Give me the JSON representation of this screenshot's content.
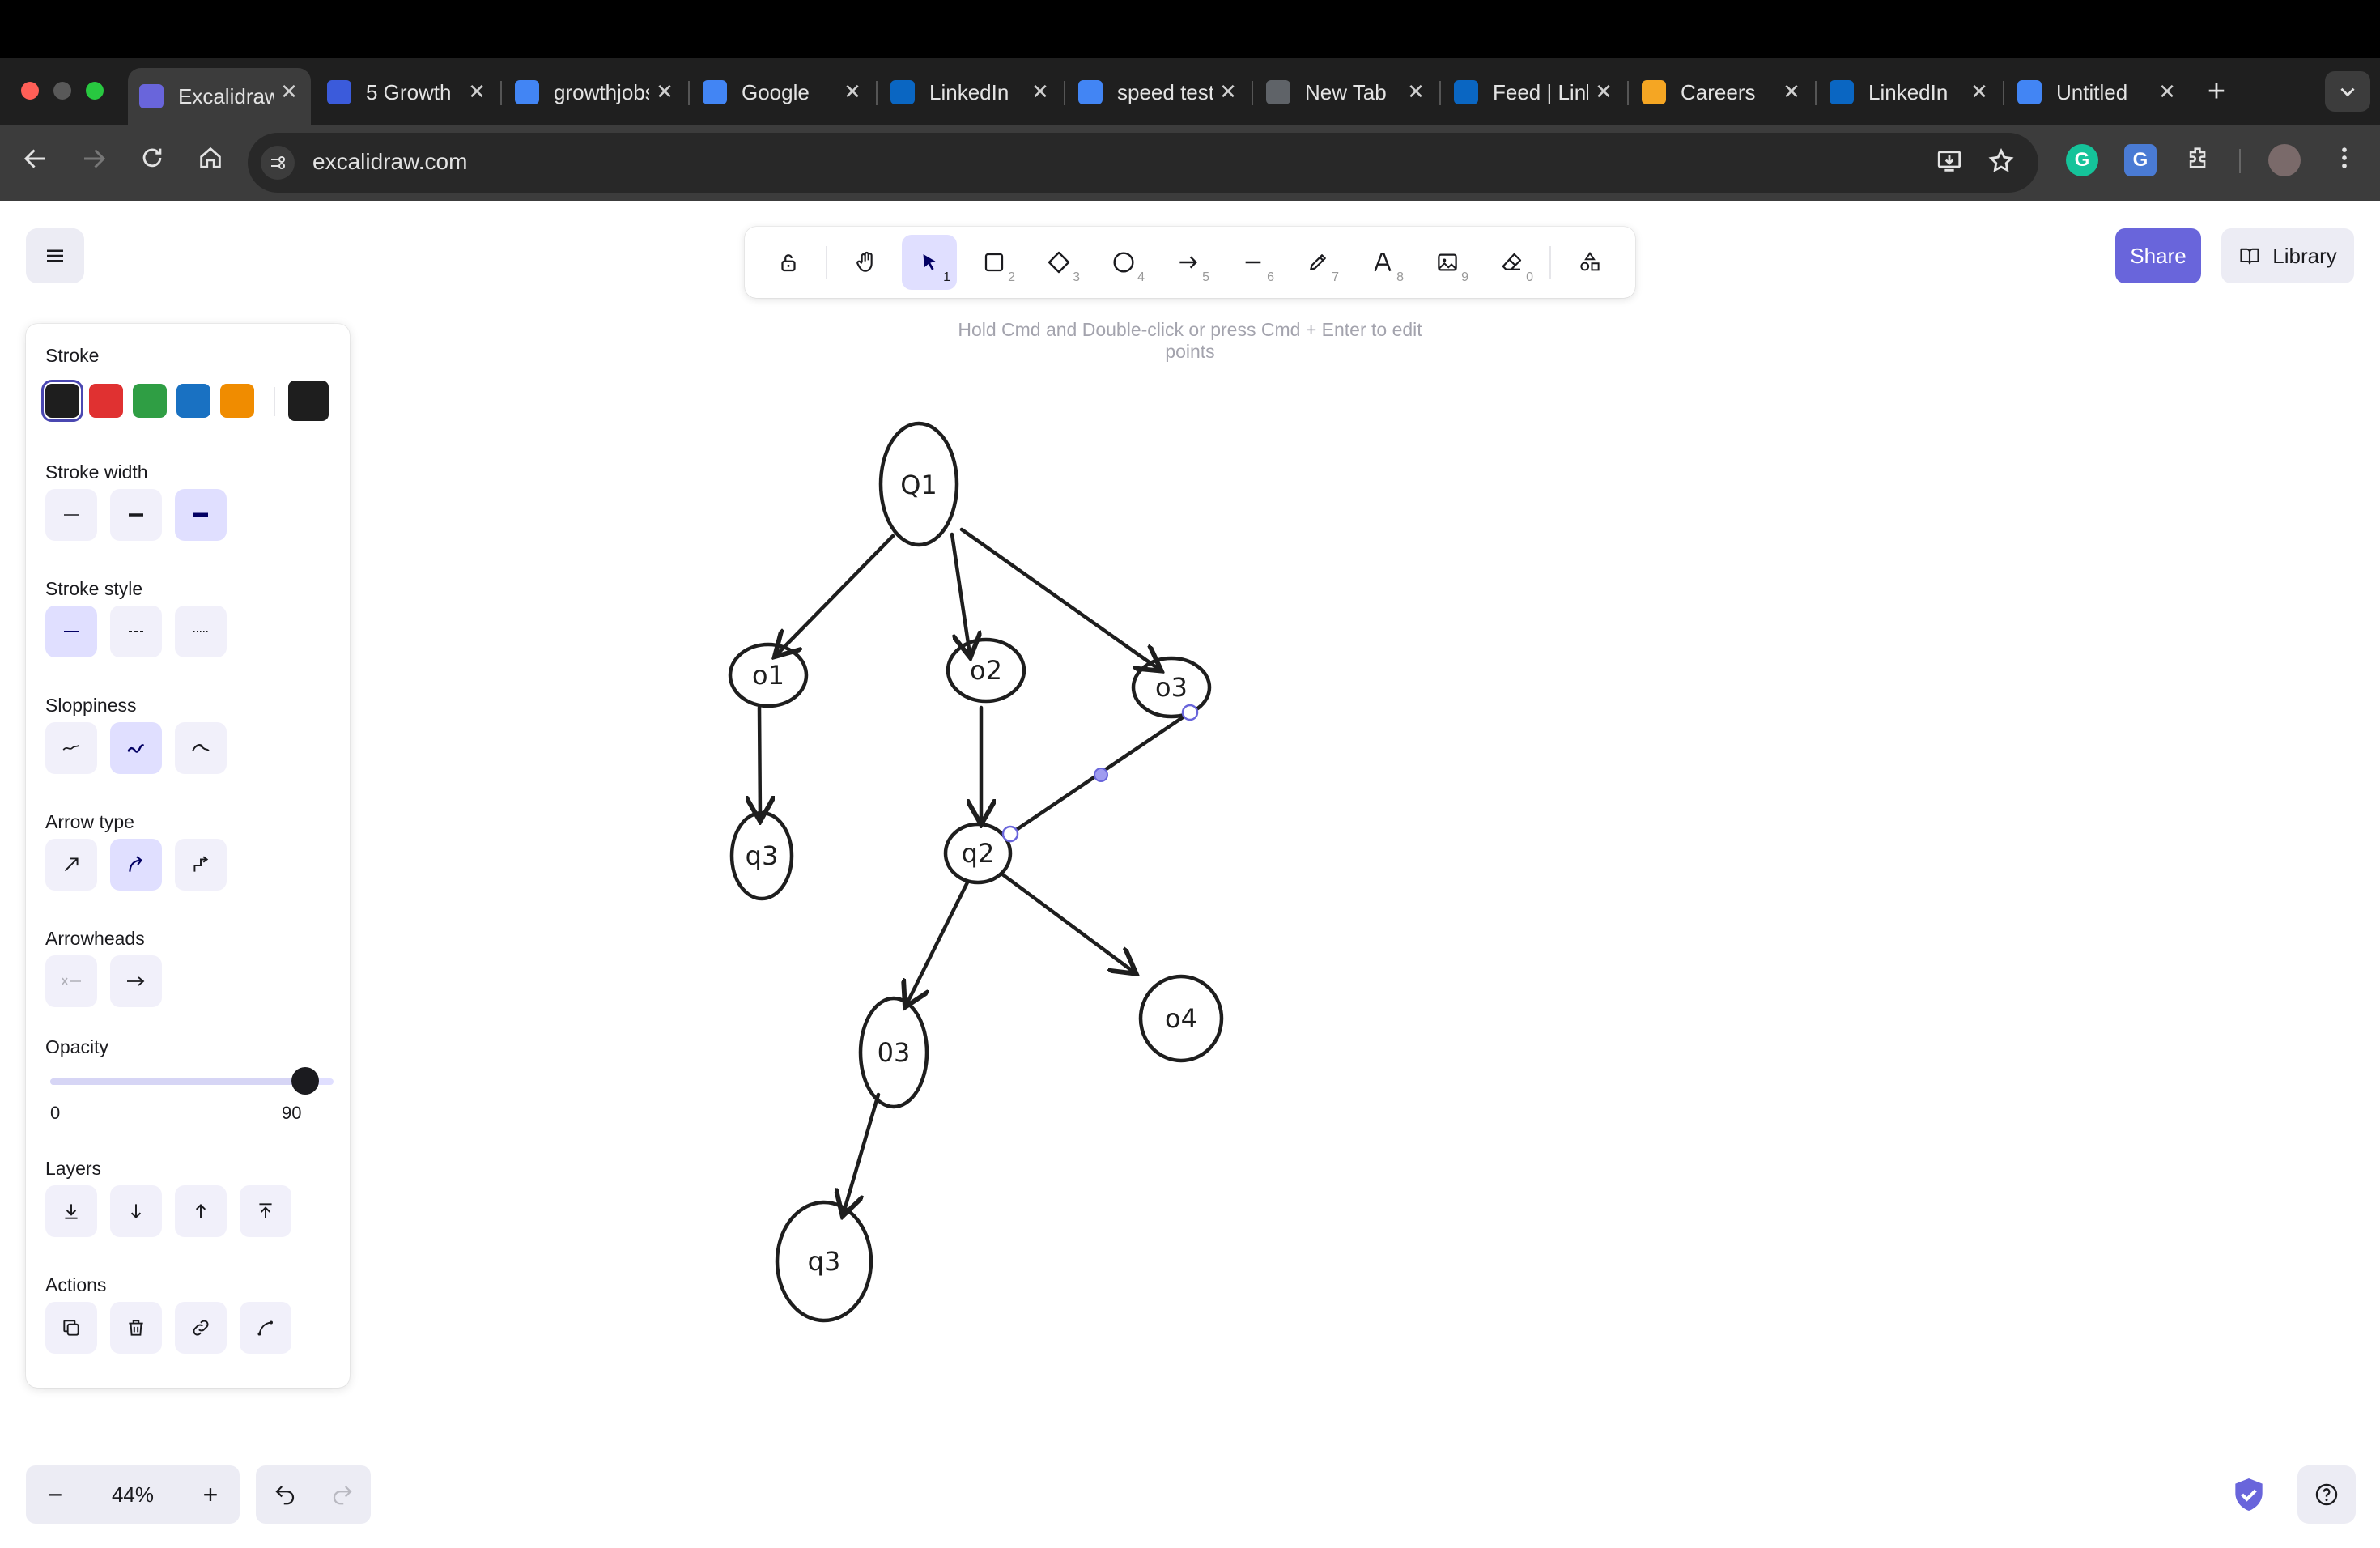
{
  "browser": {
    "tabs": [
      {
        "title": "Excalidraw",
        "favicon": "excalidraw-icon",
        "color": "#6965db",
        "active": true
      },
      {
        "title": "5 Growth",
        "favicon": "growth-icon",
        "color": "#3b5bdb",
        "active": false
      },
      {
        "title": "growthjobs",
        "favicon": "google-icon",
        "color": "#4285f4",
        "active": false
      },
      {
        "title": "Google",
        "favicon": "gemini-icon",
        "color": "#4285f4",
        "active": false
      },
      {
        "title": "LinkedIn",
        "favicon": "linkedin-icon",
        "color": "#0a66c2",
        "active": false
      },
      {
        "title": "speed test",
        "favicon": "google-icon",
        "color": "#4285f4",
        "active": false
      },
      {
        "title": "New Tab",
        "favicon": "chrome-icon",
        "color": "#5f6368",
        "active": false
      },
      {
        "title": "Feed | LinkedIn",
        "favicon": "linkedin-icon",
        "color": "#0a66c2",
        "active": false
      },
      {
        "title": "Careers",
        "favicon": "careers-icon",
        "color": "#f5a623",
        "active": false
      },
      {
        "title": "LinkedIn",
        "favicon": "linkedin-icon",
        "color": "#0a66c2",
        "active": false
      },
      {
        "title": "Untitled",
        "favicon": "docs-icon",
        "color": "#4285f4",
        "active": false
      }
    ],
    "url": "excalidraw.com",
    "close_glyph": "✕",
    "new_tab_glyph": "+"
  },
  "toolbar": {
    "tools": [
      {
        "name": "lock",
        "key": ""
      },
      {
        "name": "hand",
        "key": ""
      },
      {
        "name": "selection",
        "key": "1",
        "active": true
      },
      {
        "name": "rectangle",
        "key": "2"
      },
      {
        "name": "diamond",
        "key": "3"
      },
      {
        "name": "ellipse",
        "key": "4"
      },
      {
        "name": "arrow",
        "key": "5"
      },
      {
        "name": "line",
        "key": "6"
      },
      {
        "name": "draw",
        "key": "7"
      },
      {
        "name": "text",
        "key": "8"
      },
      {
        "name": "image",
        "key": "9"
      },
      {
        "name": "eraser",
        "key": "0"
      },
      {
        "name": "extra-tools",
        "key": ""
      }
    ],
    "hint": "Hold Cmd and Double-click or press Cmd + Enter to edit points"
  },
  "top_right": {
    "share_label": "Share",
    "library_label": "Library"
  },
  "panel": {
    "stroke_label": "Stroke",
    "stroke_colors": [
      "#1e1e1e",
      "#e03131",
      "#2f9e44",
      "#1971c2",
      "#f08c00"
    ],
    "stroke_current": "#1e1e1e",
    "stroke_width_label": "Stroke width",
    "stroke_style_label": "Stroke style",
    "sloppiness_label": "Sloppiness",
    "arrow_type_label": "Arrow type",
    "arrowheads_label": "Arrowheads",
    "opacity_label": "Opacity",
    "opacity_min": "0",
    "opacity_value": "90",
    "opacity_fraction": 0.9,
    "layers_label": "Layers",
    "actions_label": "Actions"
  },
  "footer": {
    "zoom": "44%",
    "zoom_out": "−",
    "zoom_in": "+"
  },
  "diagram": {
    "nodes": [
      "Q1",
      "o1",
      "o2",
      "o3",
      "q3",
      "q2",
      "03",
      "o4",
      "q3"
    ]
  }
}
